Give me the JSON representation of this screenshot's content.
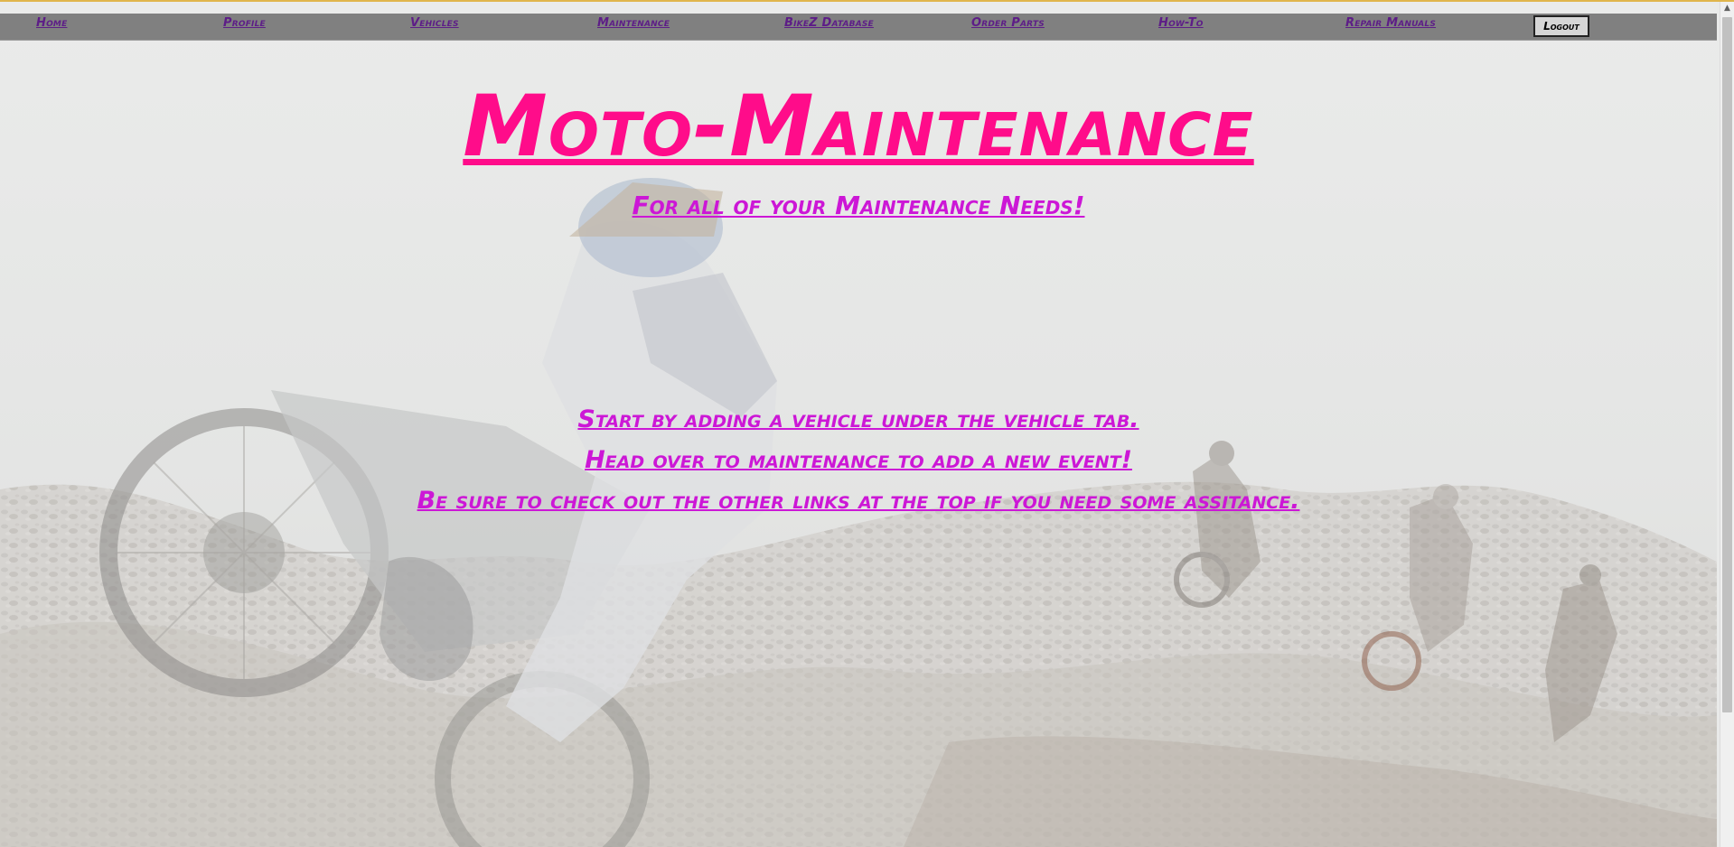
{
  "nav": {
    "items": [
      {
        "label": "Home"
      },
      {
        "label": "Profile"
      },
      {
        "label": "Vehicles"
      },
      {
        "label": "Maintenance"
      },
      {
        "label": "BikeZ Database"
      },
      {
        "label": "Order Parts"
      },
      {
        "label": "How-To"
      },
      {
        "label": "Repair Manuals"
      }
    ],
    "logout_label": "Logout"
  },
  "main": {
    "title": "Moto-Maintenance",
    "subtitle": "For all of your Maintenance Needs!",
    "messages": [
      "Start by adding a vehicle under the vehicle tab.",
      "Head over to maintenance to add a new event!",
      "Be sure to check out the other links at the top if you need some assitance."
    ]
  },
  "colors": {
    "nav_bg": "#808080",
    "nav_link": "#5d1d87",
    "title": "#ff0c8a",
    "message": "#cc17d6",
    "top_line": "#e0b54b"
  }
}
